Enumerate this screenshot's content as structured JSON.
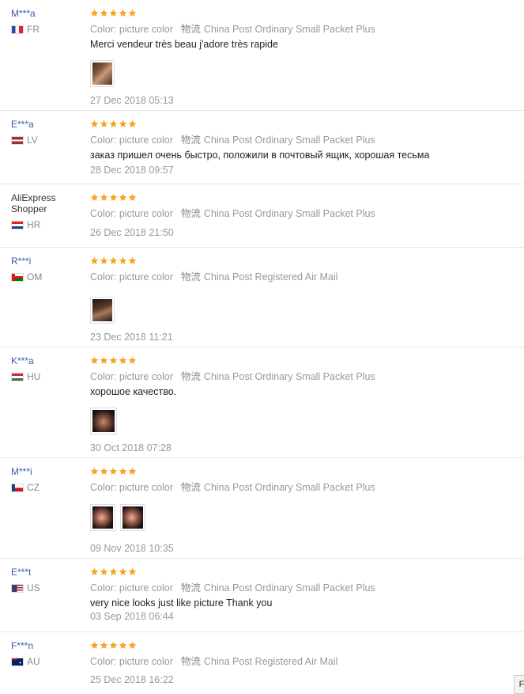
{
  "common": {
    "color_label": "Color: picture color",
    "shipping_label": "物流"
  },
  "reviews": [
    {
      "user": "M***a",
      "country": "FR",
      "shipping": "China Post Ordinary Small Packet Plus",
      "text": "Merci vendeur très beau j'adore très rapide",
      "date": "27 Dec 2018 05:13",
      "stars": 5,
      "images": 1
    },
    {
      "user": "E***a",
      "country": "LV",
      "shipping": "China Post Ordinary Small Packet Plus",
      "text": "заказ пришел очень быстро, положили в почтовый ящик, хорошая тесьма",
      "date": "28 Dec 2018 09:57",
      "stars": 5,
      "images": 0
    },
    {
      "user": "AliExpress Shopper",
      "country": "HR",
      "shipping": "China Post Ordinary Small Packet Plus",
      "text": "",
      "date": "26 Dec 2018 21:50",
      "stars": 5,
      "images": 0
    },
    {
      "user": "R***i",
      "country": "OM",
      "shipping": "China Post Registered Air Mail",
      "text": "",
      "date": "23 Dec 2018 11:21",
      "stars": 5,
      "images": 1
    },
    {
      "user": "K***a",
      "country": "HU",
      "shipping": "China Post Ordinary Small Packet Plus",
      "text": "хорошое качество.",
      "date": "30 Oct 2018 07:28",
      "stars": 5,
      "images": 1
    },
    {
      "user": "M***i",
      "country": "CZ",
      "shipping": "China Post Ordinary Small Packet Plus",
      "text": "",
      "date": "09 Nov 2018 10:35",
      "stars": 5,
      "images": 2
    },
    {
      "user": "E***t",
      "country": "US",
      "shipping": "China Post Ordinary Small Packet Plus",
      "text": "very nice looks just like picture Thank you",
      "date": "03 Sep 2018 06:44",
      "stars": 5,
      "images": 0
    },
    {
      "user": "F***n",
      "country": "AU",
      "shipping": "China Post Registered Air Mail",
      "text": "",
      "date": "25 Dec 2018 16:22",
      "stars": 5,
      "images": 0
    }
  ],
  "colors": {
    "star": "#f5a623",
    "username": "#3a5ba8",
    "meta": "#999999"
  },
  "icons": {
    "star": "star-icon",
    "flag": "country-flag-icon"
  },
  "corner_button_label": "F"
}
